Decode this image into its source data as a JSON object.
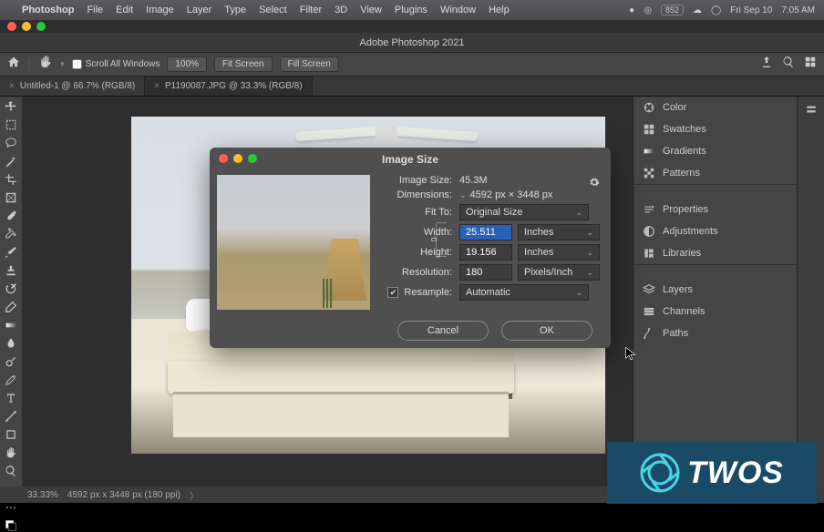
{
  "menubar": {
    "app": "Photoshop",
    "items": [
      "File",
      "Edit",
      "Image",
      "Layer",
      "Type",
      "Select",
      "Filter",
      "3D",
      "View",
      "Plugins",
      "Window",
      "Help"
    ],
    "right": {
      "badge": "852",
      "date": "Fri Sep 10",
      "time": "7:05 AM"
    }
  },
  "window": {
    "title": "Adobe Photoshop 2021"
  },
  "optionbar": {
    "scroll_label": "Scroll All Windows",
    "zoom": "100%",
    "fit": "Fit Screen",
    "fill": "Fill Screen"
  },
  "tabs": [
    {
      "label": "Untitled-1 @ 66.7% (RGB/8)"
    },
    {
      "label": "P1190087.JPG @ 33.3% (RGB/8)"
    }
  ],
  "panels": {
    "group1": [
      "Color",
      "Swatches",
      "Gradients",
      "Patterns"
    ],
    "group2": [
      "Properties",
      "Adjustments",
      "Libraries"
    ],
    "group3": [
      "Layers",
      "Channels",
      "Paths"
    ]
  },
  "dialog": {
    "title": "Image Size",
    "image_size_label": "Image Size:",
    "image_size_value": "45.3M",
    "dimensions_label": "Dimensions:",
    "dimensions_value": "4592 px × 3448 px",
    "fit_to_label": "Fit To:",
    "fit_to_value": "Original Size",
    "width_label": "Width:",
    "width_value": "25.511",
    "width_unit": "Inches",
    "height_label": "Height:",
    "height_value": "19.156",
    "height_unit": "Inches",
    "resolution_label": "Resolution:",
    "resolution_value": "180",
    "resolution_unit": "Pixels/Inch",
    "resample_label": "Resample:",
    "resample_value": "Automatic",
    "cancel": "Cancel",
    "ok": "OK"
  },
  "statusbar": {
    "zoom": "33.33%",
    "info": "4592 px x 3448 px (180 ppi)"
  },
  "overlay": {
    "brand": "TWOS"
  }
}
